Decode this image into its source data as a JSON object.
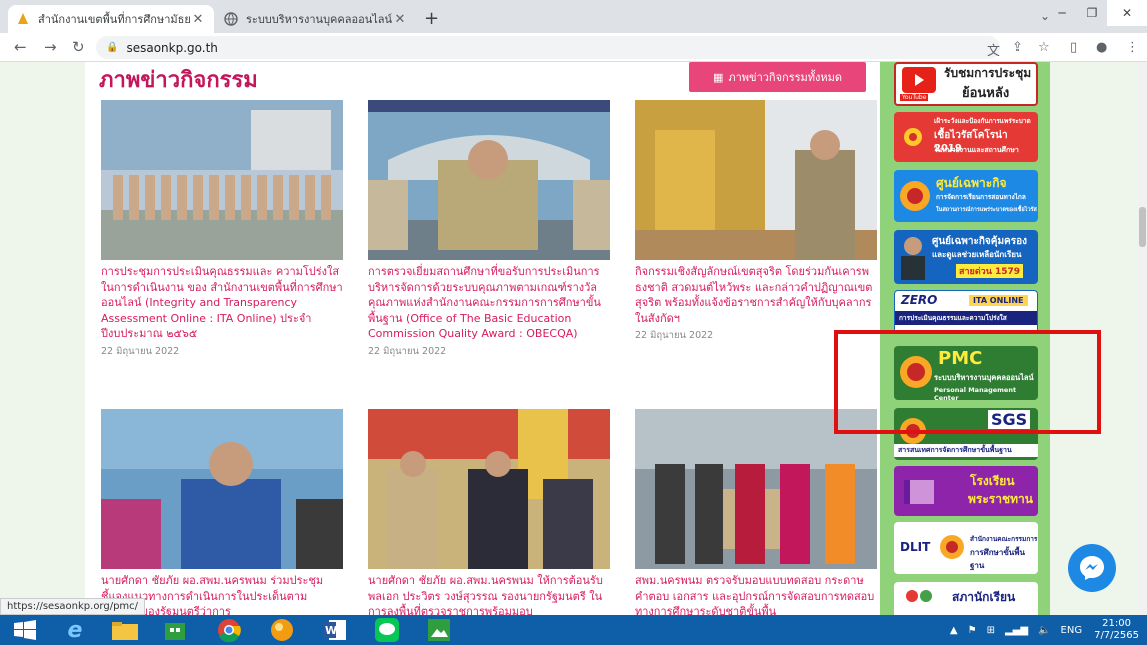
{
  "browser": {
    "tabs": [
      {
        "title": "สำนักงานเขตพื้นที่การศึกษามัธยมศึกษา",
        "active": true
      },
      {
        "title": "ระบบบริหารงานบุคคลออนไลน์ สพม.นครพนม",
        "active": false
      }
    ],
    "new_tab": "+",
    "address": "sesaonkp.go.th",
    "status_url": "https://sesaonkp.org/pmc/"
  },
  "page": {
    "heading": "ภาพข่าวกิจกรรม",
    "all_button": "ภาพข่าวกิจกรรมทั้งหมด",
    "news": [
      {
        "title": "การประชุมการประเมินคุณธรรมและ ความโปร่งใสในการดำเนินงาน ของ สำนักงานเขตพื้นที่การศึกษาออนไลน์ (Integrity and Transparency Assessment Online : ITA Online) ประจำปีงบประมาณ ๒๕๖๕",
        "date": "22 มิถุนายน 2022"
      },
      {
        "title": "การตรวจเยี่ยมสถานศึกษาที่ขอรับการประเมินการบริหารจัดการด้วยระบบคุณภาพตามเกณฑ์รางวัลคุณภาพแห่งสำนักงานคณะกรรมการการศึกษาขั้นพื้นฐาน (Office of The Basic Education Commission Quality Award : OBECQA)",
        "date": "22 มิถุนายน 2022"
      },
      {
        "title": "กิจกรรมเชิงสัญลักษณ์เขตสุจริต โดยร่วมกันเคารพธงชาติ สวดมนต์ไหว้พระ และกล่าวคำปฏิญาณเขตสุจริต พร้อมทั้งแจ้งข้อราชการสำคัญให้กับบุคลากรในสังกัดฯ",
        "date": "22 มิถุนายน 2022"
      },
      {
        "title": "นายศักดา ชัยภัย ผอ.สพม.นครพนม ร่วมประชุมชี้แจงแนวทางการดำเนินการในประเด็นตามนโยบายของรัฐมนตรีว่าการ",
        "date": ""
      },
      {
        "title": "นายศักดา ชัยภัย ผอ.สพม.นครพนม ให้การต้อนรับ พลเอก ประวิตร วงษ์สุวรรณ รองนายกรัฐมนตรี ในการลงพื้นที่ตรวจราชการพร้อมมอบ",
        "date": ""
      },
      {
        "title": "สพม.นครพนม ตรวจรับมอบแบบทดสอบ กระดาษคำตอบ เอกสาร และอุปกรณ์การจัดสอบการทดสอบทางการศึกษาระดับชาติขั้นพื้น",
        "date": ""
      }
    ]
  },
  "sidebar": {
    "banners": [
      {
        "line1": "รับชมการประชุม",
        "line2": "ย้อนหลัง",
        "tag": "YouTube"
      },
      {
        "line1": "เฝ้าระวังและป้องกันการแพร่ระบาด",
        "line2": "เชื้อไวรัสโคโรน่า 2019",
        "line3": "ในหน่วยงานและสถานศึกษา"
      },
      {
        "line1": "ศูนย์เฉพาะกิจ",
        "line2": "การจัดการเรียนการสอนทางไกล",
        "line3": "ในสถานการณ์การแพร่ระบาดของเชื้อไวรัส"
      },
      {
        "line1": "ศูนย์เฉพาะกิจคุ้มครอง",
        "line2": "และดูแลช่วยเหลือนักเรียน",
        "line3": "สายด่วน 1579"
      },
      {
        "line1": "ZERO",
        "line2": "ITA ONLINE",
        "line3": "การประเมินคุณธรรมและความโปร่งใส"
      },
      {
        "line1": "PMC",
        "line2": "ระบบบริหารงานบุคคลออนไลน์",
        "line3": "Personal Management Center"
      },
      {
        "line1": "SGS",
        "line2": "สารสนเทศการจัดการศึกษาขั้นพื้นฐาน"
      },
      {
        "line1": "โรงเรียน",
        "line2": "พระราชทาน"
      },
      {
        "line1": "DLIT",
        "line2": "สำนักงานคณะกรรมการ",
        "line3": "การศึกษาขั้นพื้นฐาน"
      },
      {
        "line1": "สภานักเรียน"
      }
    ]
  },
  "taskbar": {
    "language": "ENG",
    "time": "21:00",
    "date": "7/7/2565"
  },
  "colors": {
    "accent": "#c2185b",
    "sidebar": "#8fd27a",
    "highlight_box": "#e01010"
  }
}
